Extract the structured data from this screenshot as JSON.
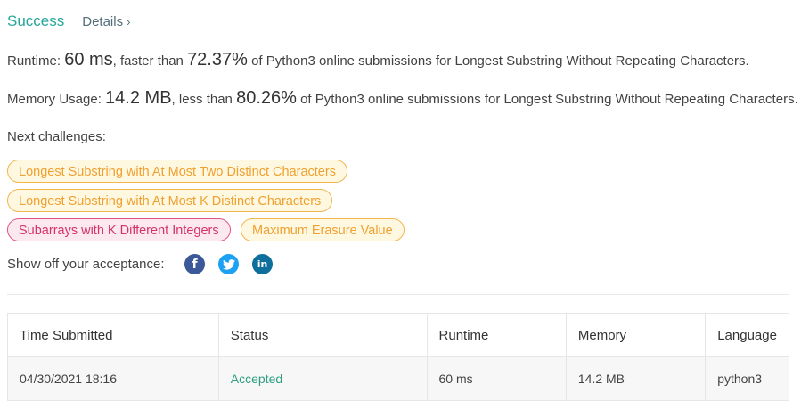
{
  "header": {
    "status": "Success",
    "details_label": "Details",
    "details_chevron": "›"
  },
  "runtime": {
    "label": "Runtime:",
    "value": "60 ms",
    "middle": ", faster than",
    "percent": "72.37%",
    "suffix": "of Python3 online submissions for Longest Substring Without Repeating Characters."
  },
  "memory": {
    "label": "Memory Usage:",
    "value": "14.2 MB",
    "middle": ", less than",
    "percent": "80.26%",
    "suffix": "of Python3 online submissions for Longest Substring Without Repeating Characters."
  },
  "next_challenges": {
    "label": "Next challenges:",
    "items": [
      {
        "label": "Longest Substring with At Most Two Distinct Characters",
        "difficulty_color": "#f0a030"
      },
      {
        "label": "Longest Substring with At Most K Distinct Characters",
        "difficulty_color": "#f0a030"
      },
      {
        "label": "Subarrays with K Different Integers",
        "difficulty_color": "#d6336c"
      },
      {
        "label": "Maximum Erasure Value",
        "difficulty_color": "#f0a030"
      }
    ]
  },
  "share": {
    "label": "Show off your acceptance:",
    "icons": [
      {
        "name": "facebook-icon",
        "glyph": "f",
        "color": "#3b5998"
      },
      {
        "name": "twitter-icon",
        "glyph": "",
        "color": "#1da1f2"
      },
      {
        "name": "linkedin-icon",
        "glyph": "in",
        "color": "#0e6f9c"
      }
    ]
  },
  "submissions": {
    "headers": [
      "Time Submitted",
      "Status",
      "Runtime",
      "Memory",
      "Language"
    ],
    "rows": [
      [
        "04/30/2021 18:16",
        "Accepted",
        "60 ms",
        "14.2 MB",
        "python3"
      ]
    ]
  }
}
